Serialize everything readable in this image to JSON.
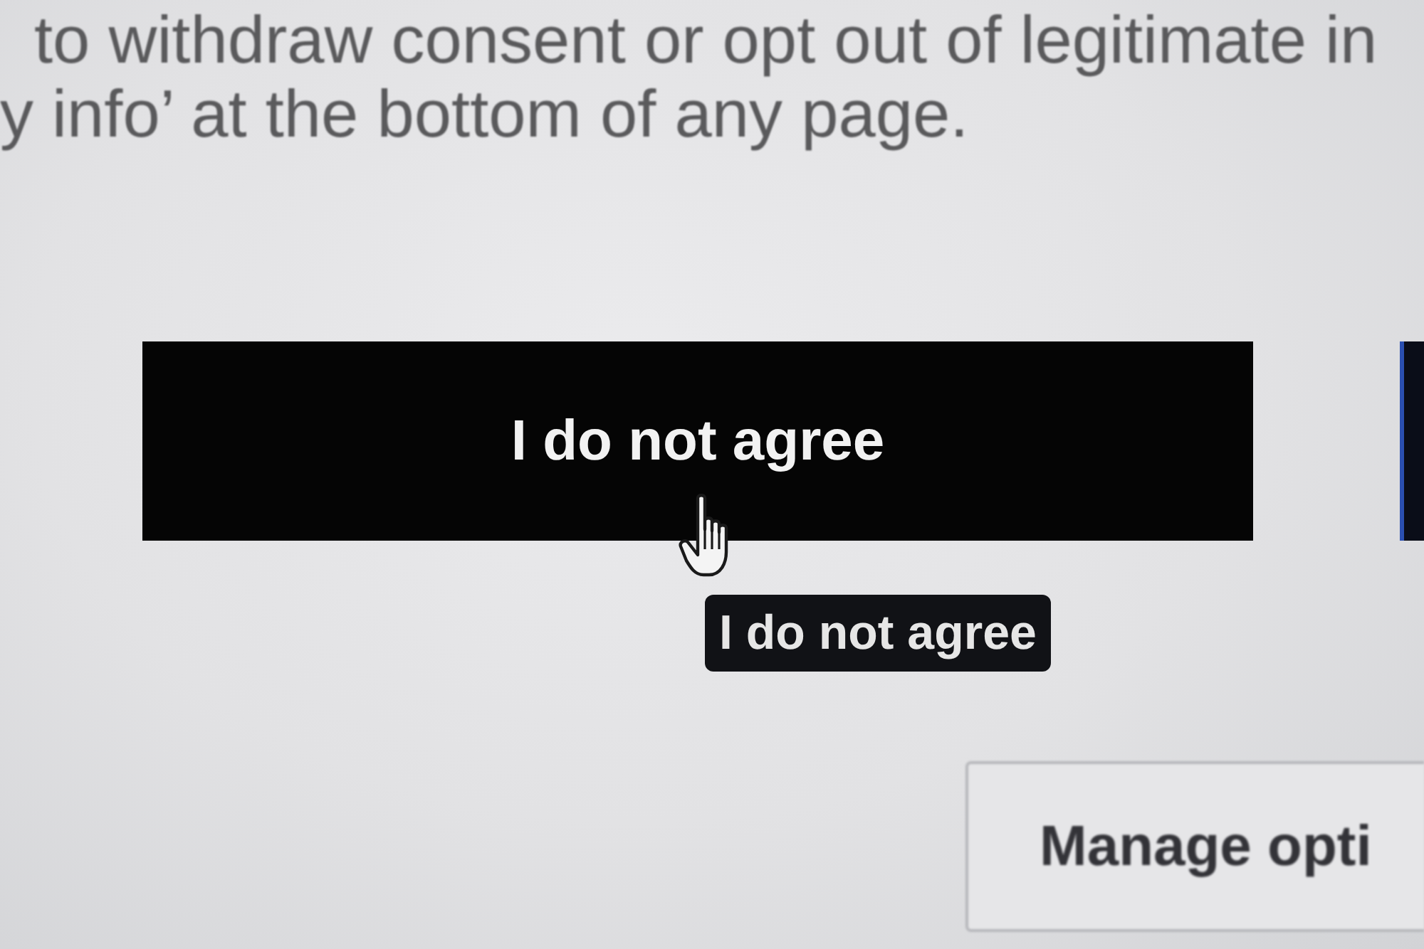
{
  "paragraph": {
    "lines": [
      "to withdraw consent or opt out of legitimate in",
      "y info’ at the bottom of any page."
    ]
  },
  "primary_button": {
    "label": "I do not agree"
  },
  "tooltip": {
    "text": "I do not agree"
  },
  "secondary_button": {
    "label": "Manage opti"
  }
}
